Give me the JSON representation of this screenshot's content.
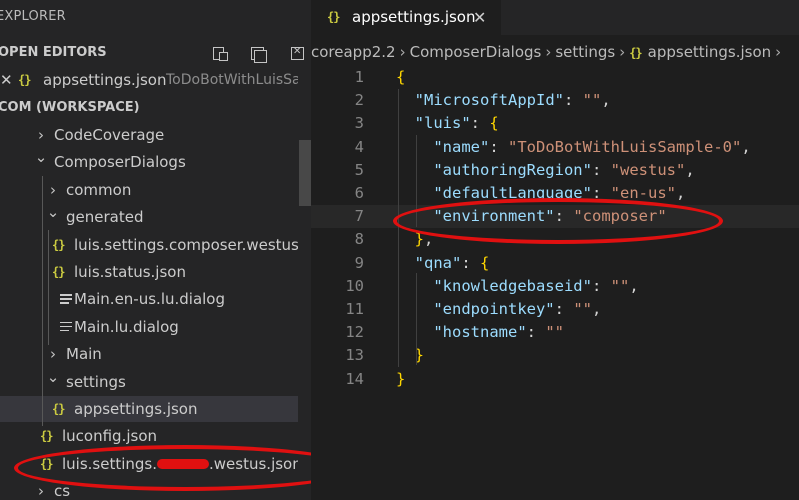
{
  "sidebar": {
    "title": "EXPLORER",
    "open_editors": {
      "label": "OPEN EDITORS",
      "item_icon": "{}",
      "item_name": "appsettings.json",
      "item_desc": "ToDoBotWithLuisSa..."
    },
    "workspace": {
      "label": "COM (WORKSPACE)",
      "items": [
        {
          "label": "CodeCoverage",
          "type": "folder",
          "state": "collapsed"
        },
        {
          "label": "ComposerDialogs",
          "type": "folder",
          "state": "expanded"
        },
        {
          "label": "common",
          "type": "folder",
          "state": "collapsed"
        },
        {
          "label": "generated",
          "type": "folder",
          "state": "expanded"
        },
        {
          "label": "luis.settings.composer.westus.j...",
          "type": "json"
        },
        {
          "label": "luis.status.json",
          "type": "json"
        },
        {
          "label": "Main.en-us.lu.dialog",
          "type": "file"
        },
        {
          "label": "Main.lu.dialog",
          "type": "file"
        },
        {
          "label": "Main",
          "type": "folder",
          "state": "collapsed"
        },
        {
          "label": "settings",
          "type": "folder",
          "state": "expanded"
        },
        {
          "label": "appsettings.json",
          "type": "json",
          "selected": true
        },
        {
          "label": "luconfig.json",
          "type": "json"
        },
        {
          "label": "luis.settings.",
          "label_after": ".westus.json",
          "type": "json"
        },
        {
          "label": "cs",
          "type": "folder",
          "state": "collapsed"
        }
      ]
    }
  },
  "editor": {
    "tab": {
      "icon": "{}",
      "label": "appsettings.json",
      "close": "✕"
    },
    "breadcrumbs": [
      "coreapp2.2",
      "ComposerDialogs",
      "settings",
      "appsettings.json"
    ],
    "lines": [
      "{",
      "  \"MicrosoftAppId\": \"\",",
      "  \"luis\": {",
      "    \"name\": \"ToDoBotWithLuisSample-0\",",
      "    \"authoringRegion\": \"westus\",",
      "    \"defaultLanguage\": \"en-us\",",
      "    \"environment\": \"composer\"",
      "  },",
      "  \"qna\": {",
      "    \"knowledgebaseid\": \"\",",
      "    \"endpointkey\": \"\",",
      "    \"hostname\": \"\"",
      "  }",
      "}"
    ]
  },
  "colors": {
    "annotation": "#e01010",
    "json_icon": "#cbcb41",
    "key": "#9cdcfe",
    "string": "#ce9178"
  }
}
